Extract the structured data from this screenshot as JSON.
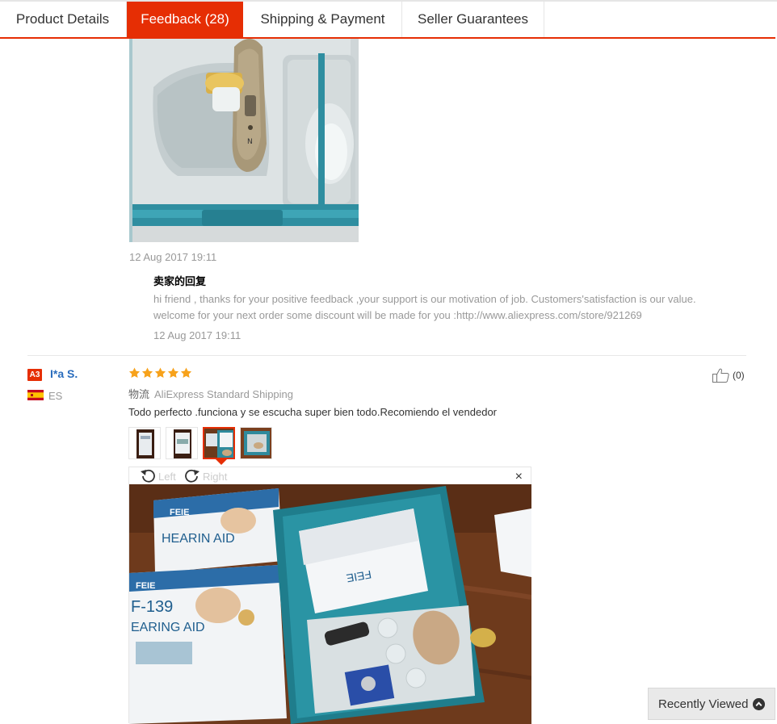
{
  "tabs": [
    {
      "label": "Product Details"
    },
    {
      "label": "Feedback (28)"
    },
    {
      "label": "Shipping & Payment"
    },
    {
      "label": "Seller Guarantees"
    }
  ],
  "first_review": {
    "date": "12 Aug 2017 19:11",
    "reply": {
      "title": "卖家的回复",
      "text": "hi friend , thanks for your positive feedback ,your support is our motivation of job. Customers'satisfaction is our value. welcome for your next order some discount will be made for you :http://www.aliexpress.com/store/921269",
      "date": "12 Aug 2017 19:11"
    }
  },
  "review": {
    "level_badge": "A3",
    "user_name": "I*a S.",
    "country": "ES",
    "rating": 5,
    "shipping_label": "物流",
    "shipping_method": "AliExpress Standard Shipping",
    "text": "Todo perfecto .funciona y se escucha super bien todo.Recomiendo el vendedor",
    "helpful_count": "(0)",
    "viewer": {
      "rotate_left": "Left",
      "rotate_right": "Right",
      "close": "×"
    }
  },
  "recently_viewed": "Recently Viewed",
  "colors": {
    "accent": "#e62e04",
    "star": "#f7a21b",
    "link": "#2a6dbd"
  }
}
